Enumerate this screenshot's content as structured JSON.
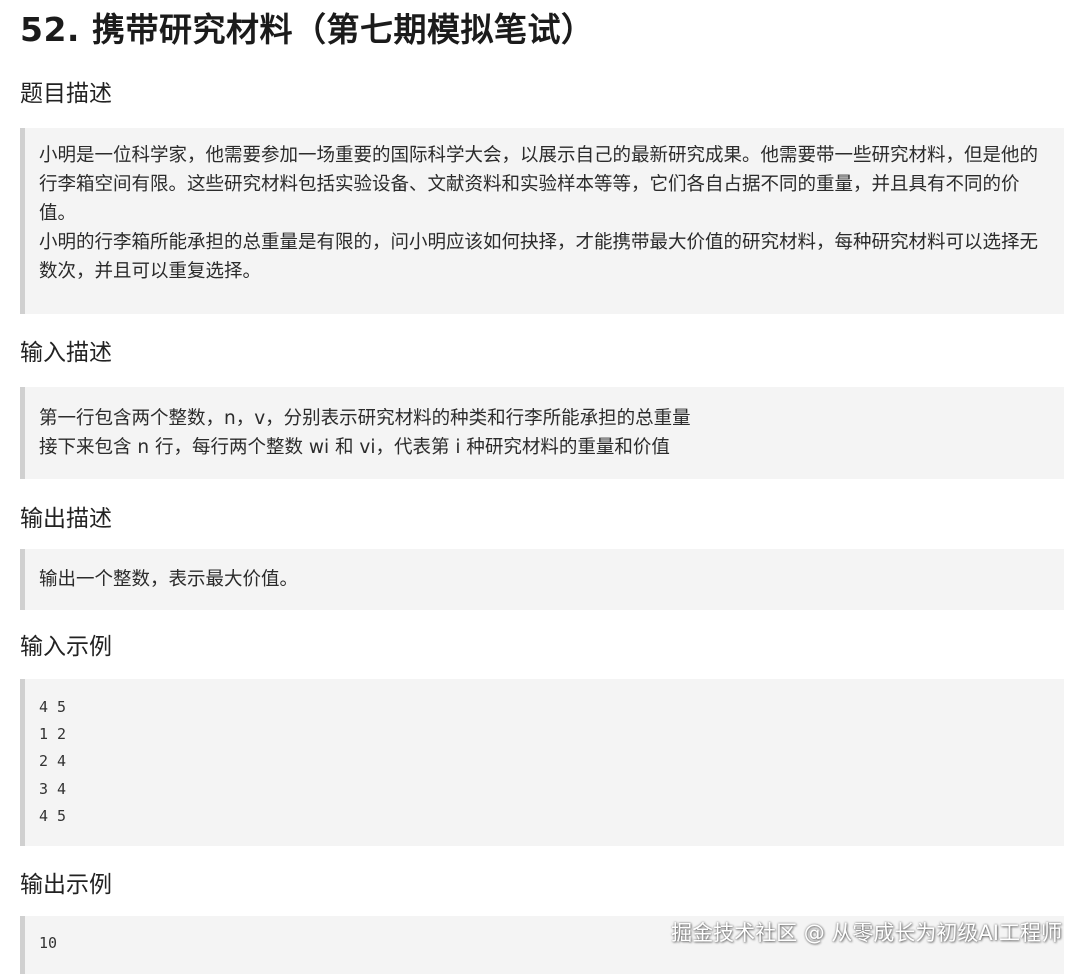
{
  "title": "52. 携带研究材料（第七期模拟笔试）",
  "sections": {
    "problem": {
      "heading": "题目描述",
      "paragraphs": [
        "小明是一位科学家，他需要参加一场重要的国际科学大会，以展示自己的最新研究成果。他需要带一些研究材料，但是他的行李箱空间有限。这些研究材料包括实验设备、文献资料和实验样本等等，它们各自占据不同的重量，并且具有不同的价值。",
        "小明的行李箱所能承担的总重量是有限的，问小明应该如何抉择，才能携带最大价值的研究材料，每种研究材料可以选择无数次，并且可以重复选择。"
      ]
    },
    "input": {
      "heading": "输入描述",
      "paragraphs": [
        "第一行包含两个整数，n，v，分别表示研究材料的种类和行李所能承担的总重量",
        "接下来包含 n 行，每行两个整数 wi 和 vi，代表第 i 种研究材料的重量和价值"
      ]
    },
    "output": {
      "heading": "输出描述",
      "paragraphs": [
        "输出一个整数，表示最大价值。"
      ]
    },
    "sample_input": {
      "heading": "输入示例",
      "lines": [
        "4 5",
        "1 2",
        "2 4",
        "3 4",
        "4 5"
      ]
    },
    "sample_output": {
      "heading": "输出示例",
      "lines": [
        "10"
      ]
    }
  },
  "watermark": "掘金技术社区 @ 从零成长为初级AI工程师"
}
